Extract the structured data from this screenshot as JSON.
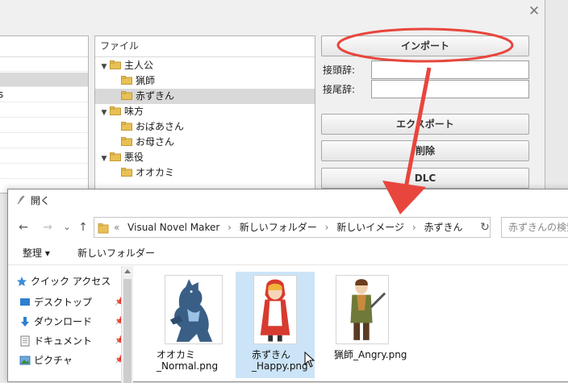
{
  "background_dialog": {
    "file_panel_header": "ファイル",
    "tree": [
      {
        "label": "主人公",
        "expanded": true,
        "level": 0
      },
      {
        "label": "猟師",
        "level": 1
      },
      {
        "label": "赤ずきん",
        "level": 1,
        "selected": true
      },
      {
        "label": "味方",
        "expanded": true,
        "level": 0
      },
      {
        "label": "おばあさん",
        "level": 1
      },
      {
        "label": "お母さん",
        "level": 1
      },
      {
        "label": "悪役",
        "expanded": true,
        "level": 0
      },
      {
        "label": "オオカミ",
        "level": 1
      }
    ],
    "left_panel_fragment": "s",
    "buttons": {
      "import": "インポート",
      "export": "エクスポート",
      "delete": "削除",
      "dlc": "DLC"
    },
    "prefix_label": "接頭辞:",
    "suffix_label": "接尾辞:",
    "close_glyph": "✕"
  },
  "open_dialog": {
    "title": "開く",
    "nav": {
      "back": "←",
      "forward": "→",
      "recent": "⌄",
      "up": "↑",
      "refresh": "↻"
    },
    "address": {
      "lead": "«",
      "parts": [
        "Visual Novel Maker",
        "新しいフォルダー",
        "新しいイメージ",
        "赤ずきん"
      ],
      "separator": "›"
    },
    "search_placeholder": "赤ずきんの検索",
    "toolbar": {
      "organize": "整理 ▾",
      "new_folder": "新しいフォルダー"
    },
    "nav_pane": [
      {
        "label": "クイック アクセス",
        "icon": "star-icon"
      },
      {
        "label": "デスクトップ",
        "icon": "desktop-icon",
        "pinned": true
      },
      {
        "label": "ダウンロード",
        "icon": "download-icon",
        "pinned": true
      },
      {
        "label": "ドキュメント",
        "icon": "document-icon",
        "pinned": true
      },
      {
        "label": "ピクチャ",
        "icon": "picture-icon",
        "pinned": true
      }
    ],
    "files": [
      {
        "name": "オオカミ\n_Normal.png",
        "line1": "オオカミ",
        "line2": "_Normal.png",
        "selected": false
      },
      {
        "name": "赤ずきん\n_Happy.png",
        "line1": "赤ずきん",
        "line2": "_Happy.png",
        "selected": true
      },
      {
        "name": "猟師_Angry.png",
        "line1": "猟師_Angry.png",
        "line2": "",
        "selected": false
      }
    ]
  },
  "colors": {
    "annotation_red": "#e8463d",
    "selection_blue": "#cce4f7",
    "folder_yellow": "#e8c055"
  }
}
